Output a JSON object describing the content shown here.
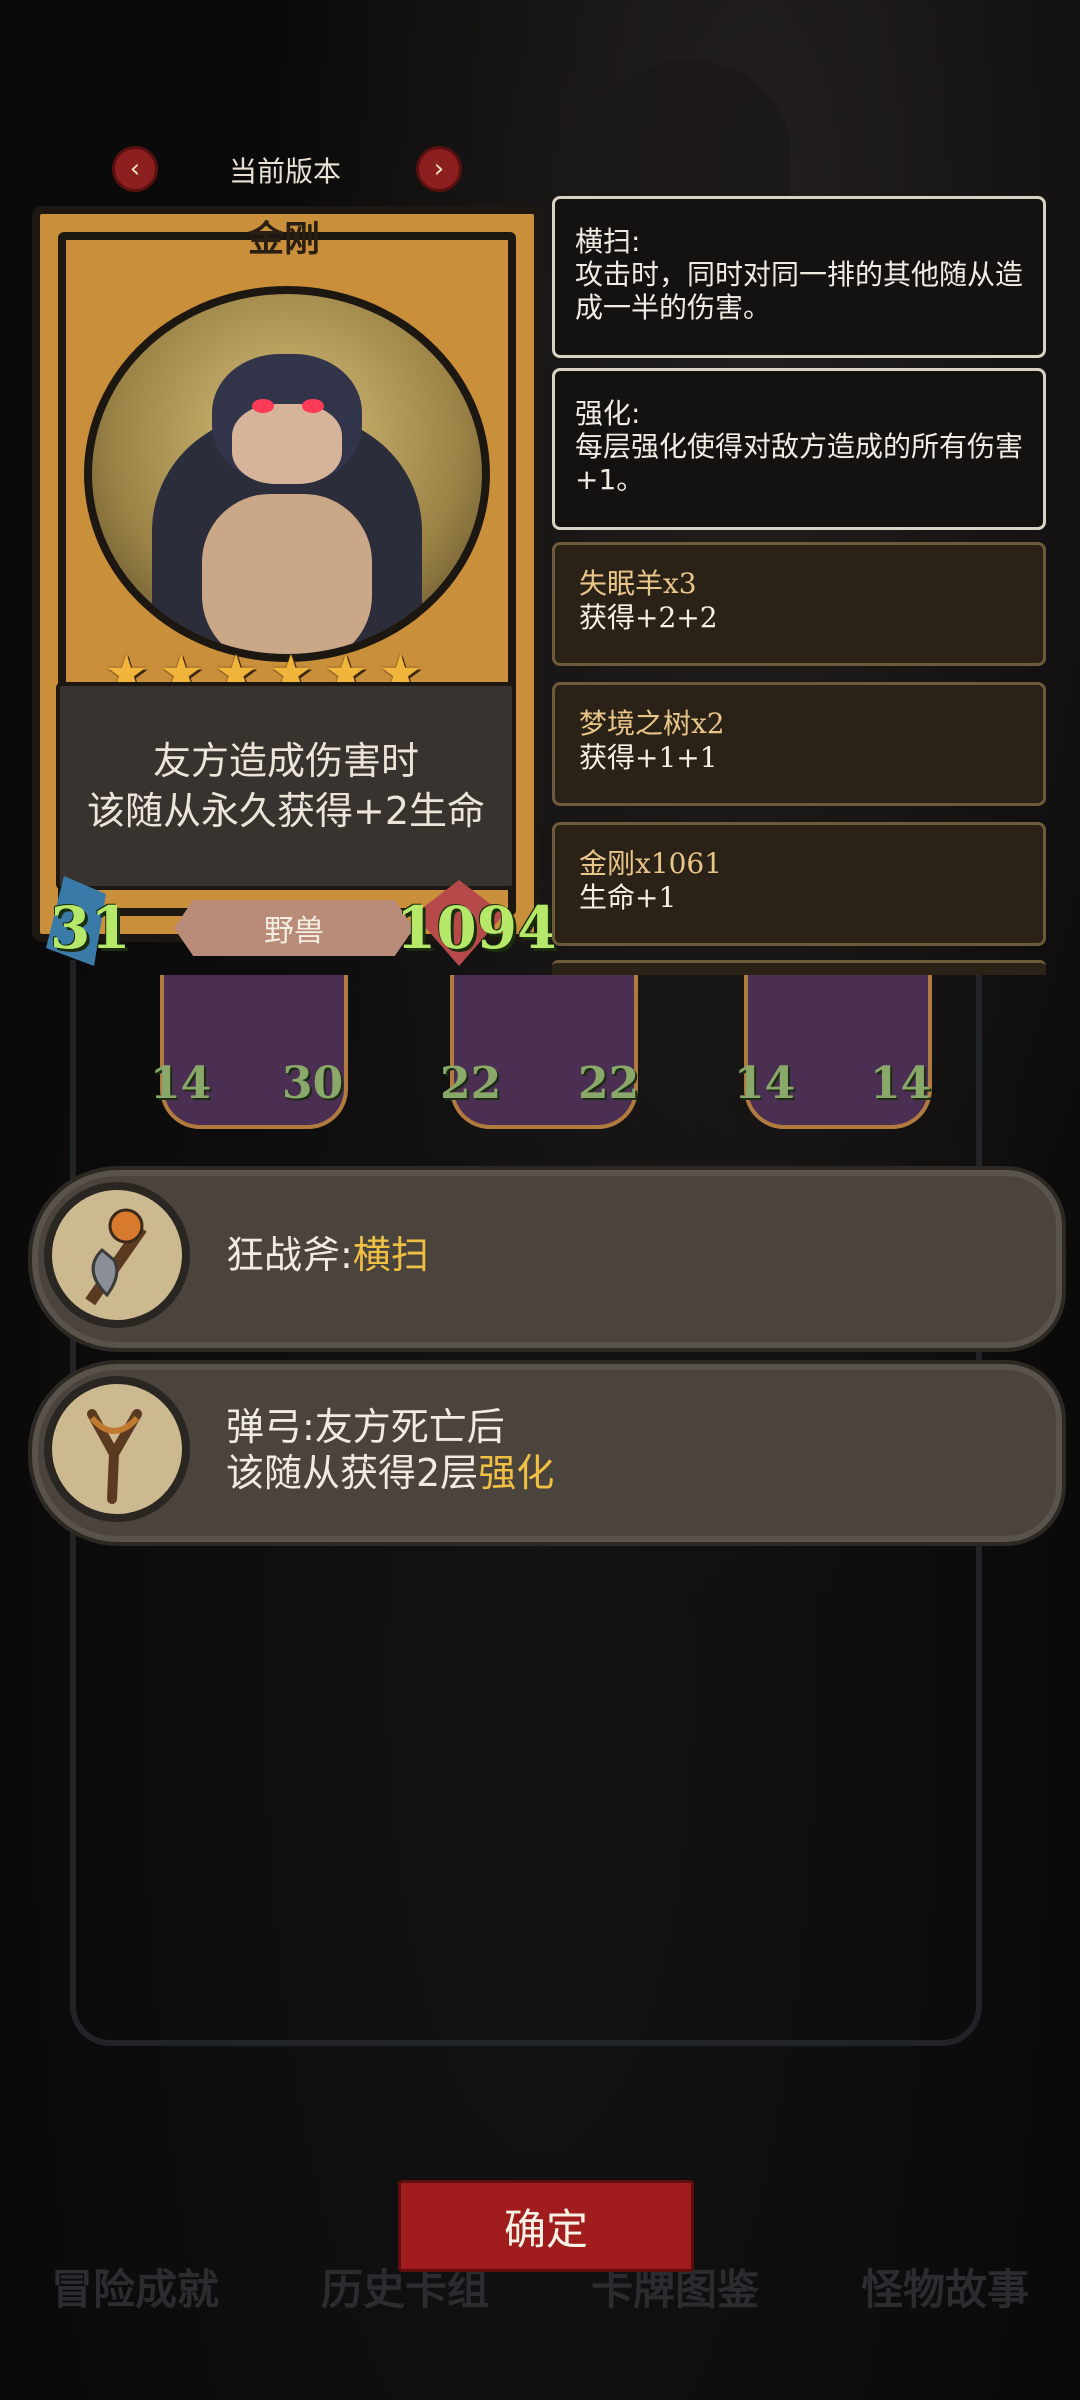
{
  "header": {
    "version_label": "当前版本",
    "prev_arrow": "‹",
    "next_arrow": "›"
  },
  "card": {
    "name": "金刚",
    "stars": [
      "★",
      "★",
      "★",
      "★",
      "★",
      "★"
    ],
    "description_lines": [
      "友方造成伤害时",
      "该随从永久获得+2生命"
    ],
    "attack": "31",
    "health": "1094",
    "tribe": "野兽"
  },
  "keywords": [
    {
      "title": "横扫:",
      "text": "攻击时，同时对同一排的其他随从造成一半的伤害。"
    },
    {
      "title": "强化:",
      "text": "每层强化使得对敌方造成的所有伤害+1。"
    }
  ],
  "buffs": [
    {
      "source": "失眠羊x3",
      "effect": "获得+2+2"
    },
    {
      "source": "梦境之树x2",
      "effect": "获得+1+1"
    },
    {
      "source": "金刚x1061",
      "effect": "生命+1"
    }
  ],
  "mini_cards": [
    {
      "attack": "14",
      "health": "30"
    },
    {
      "attack": "22",
      "health": "22"
    },
    {
      "attack": "14",
      "health": "14"
    }
  ],
  "weapons": [
    {
      "prefix": "狂战斧:",
      "highlight": "横扫",
      "line2_prefix": "",
      "line2_highlight": ""
    },
    {
      "prefix": "弹弓:友方死亡后",
      "highlight": "",
      "line2_prefix": "该随从获得2层",
      "line2_highlight": "强化"
    }
  ],
  "confirm_label": "确定",
  "bottom_tabs": [
    "冒险成就",
    "历史卡组",
    "卡牌图鉴",
    "怪物故事"
  ],
  "colors": {
    "accent_gold": "#f0c043",
    "stat_green": "#b6e96a",
    "confirm_red": "#a11d1d"
  }
}
